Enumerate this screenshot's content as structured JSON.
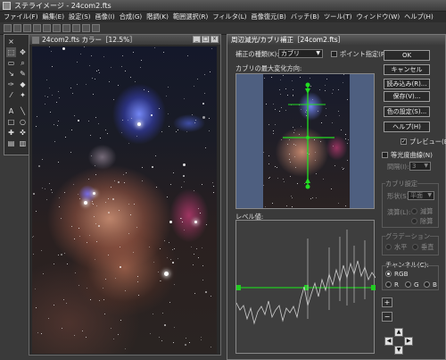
{
  "app": {
    "title": "ステライメージ - 24com2.fts"
  },
  "menu": [
    "ファイル(F)",
    "編集(E)",
    "設定(S)",
    "画像(I)",
    "合成(G)",
    "階調(K)",
    "範囲選択(R)",
    "フィルタ(L)",
    "画像復元(B)",
    "バッチ(B)",
    "ツール(T)",
    "ウィンドウ(W)",
    "ヘルプ(H)"
  ],
  "image_window": {
    "title": "24com2.fts カラー［12.5%］"
  },
  "dialog": {
    "title": "周辺減光/カブリ補正［24com2.fts］",
    "correction_type_label": "補正の種類(K):",
    "correction_type_value": "カブリ",
    "point_label": "ポイント指定(P)",
    "max_direction_label": "カブリの最大変化方向:",
    "level_label": "レベル値:",
    "preview_label": "プレビュー(E)",
    "equal_curve_label": "等光度曲線(N)",
    "interval_label": "間隔(I):",
    "interval_value": "3",
    "fog_settings_label": "カブリ設定",
    "shape_label": "形状(S):",
    "shape_value": "平面",
    "calc_label": "演算(L):",
    "subtract_label": "減算",
    "divide_label": "除算",
    "gradient_label": "グラデーション",
    "horizontal_label": "水平",
    "vertical_label": "垂直",
    "channel_label": "チャンネル(C):",
    "channel_rgb": "RGB",
    "channel_r": "R",
    "channel_g": "G",
    "channel_b": "B",
    "buttons": {
      "ok": "OK",
      "cancel": "キャンセル",
      "load": "読み込み(R)...",
      "save": "保存(V)...",
      "color_settings": "色の設定(S)...",
      "help": "ヘルプ(H)"
    },
    "plus": "+",
    "minus": "−"
  }
}
